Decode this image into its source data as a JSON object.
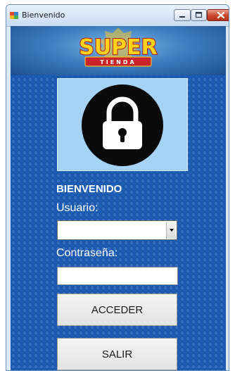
{
  "window": {
    "title": "Bienvenido"
  },
  "banner": {
    "logo_main": "SUPER",
    "logo_sub": "TIENDA"
  },
  "form": {
    "welcome": "BIENVENIDO",
    "user_label": "Usuario:",
    "user_value": "",
    "password_label": "Contraseña:",
    "password_value": "",
    "login_button": "ACCEDER",
    "exit_button": "SALIR"
  },
  "icons": {
    "app": "app-icon",
    "lock": "padlock-icon",
    "dropdown": "chevron-down-icon"
  },
  "colors": {
    "background": "#1c5fb8",
    "lock_panel": "#a5d3f3",
    "logo_yellow": "#ffd21c",
    "logo_red": "#d62a1a"
  }
}
